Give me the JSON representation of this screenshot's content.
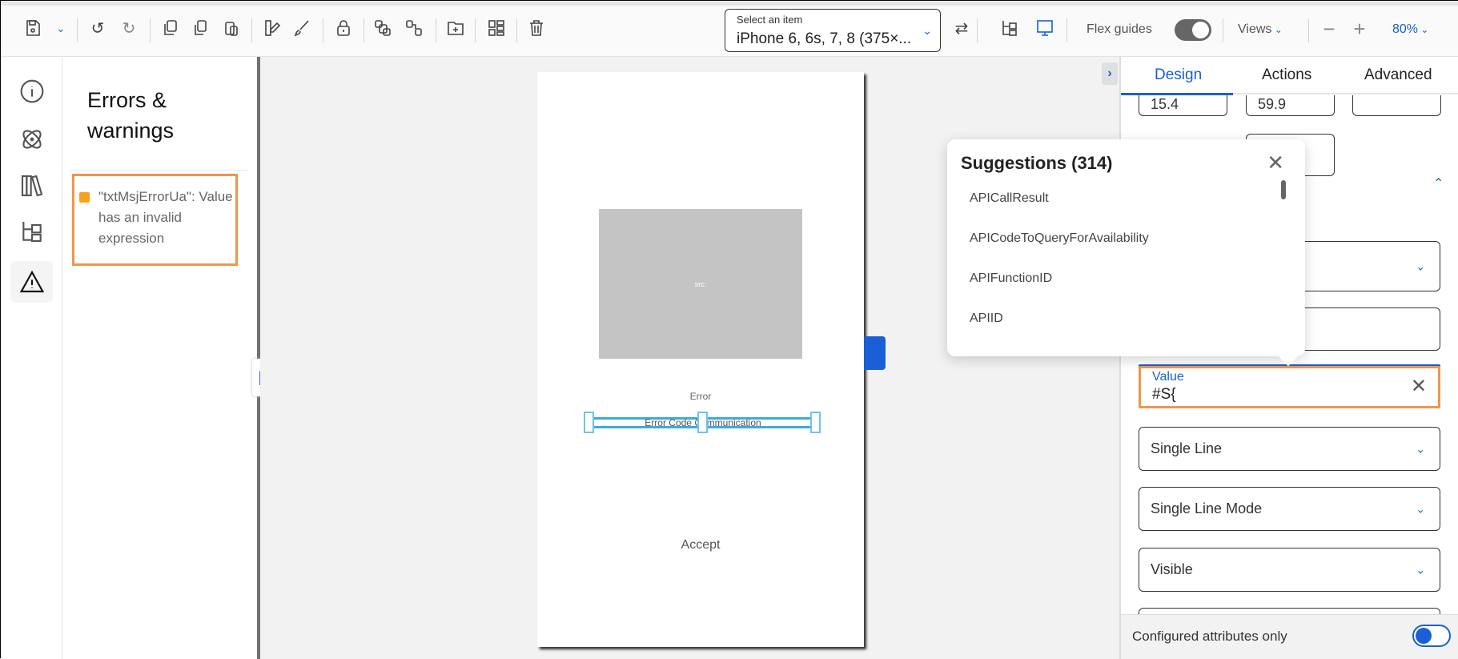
{
  "toolbar": {
    "icons": [
      "save-icon",
      "chevron-down-icon",
      "undo-icon",
      "redo-icon",
      "copy-icon",
      "duplicate-icon",
      "paste-icon",
      "theme-icon",
      "brush-icon",
      "lock-icon",
      "group-icon",
      "ungroup-icon",
      "add-folder-icon",
      "layout-icon",
      "trash-icon"
    ],
    "device_select": {
      "label": "Select an item",
      "value": "iPhone 6, 6s, 7, 8 (375×..."
    },
    "flex_guides": "Flex guides",
    "flex_guides_on": true,
    "views": "Views",
    "zoom": "80%"
  },
  "rail": {
    "items": [
      "info",
      "atom",
      "library",
      "tree",
      "warnings"
    ],
    "active": "warnings"
  },
  "errors": {
    "title": "Errors & warnings",
    "items": [
      {
        "text": "\"txtMsjErrorUa\": Value has an invalid expression",
        "color": "#f5a31a"
      }
    ]
  },
  "phone": {
    "image_label": "src:",
    "error_label": "Error",
    "error_code": "Error Code Communication",
    "accept": "Accept"
  },
  "panel": {
    "tabs": [
      "Design",
      "Actions",
      "Advanced"
    ],
    "active_tab": "Design",
    "top_fields": [
      "15.4",
      "59.9",
      ""
    ],
    "value_field": {
      "label": "Value",
      "value": "#S{"
    },
    "selects": [
      "Single Line",
      "Single Line Mode",
      "Visible"
    ],
    "footer": "Configured attributes only",
    "footer_toggle_on": true
  },
  "suggestions": {
    "title": "Suggestions (314)",
    "items": [
      "APICallResult",
      "APICodeToQueryForAvailability",
      "APIFunctionID",
      "APIID"
    ]
  },
  "colors": {
    "accent": "#1a5fd6",
    "highlight": "#f0964b",
    "warning": "#f5a31a"
  }
}
